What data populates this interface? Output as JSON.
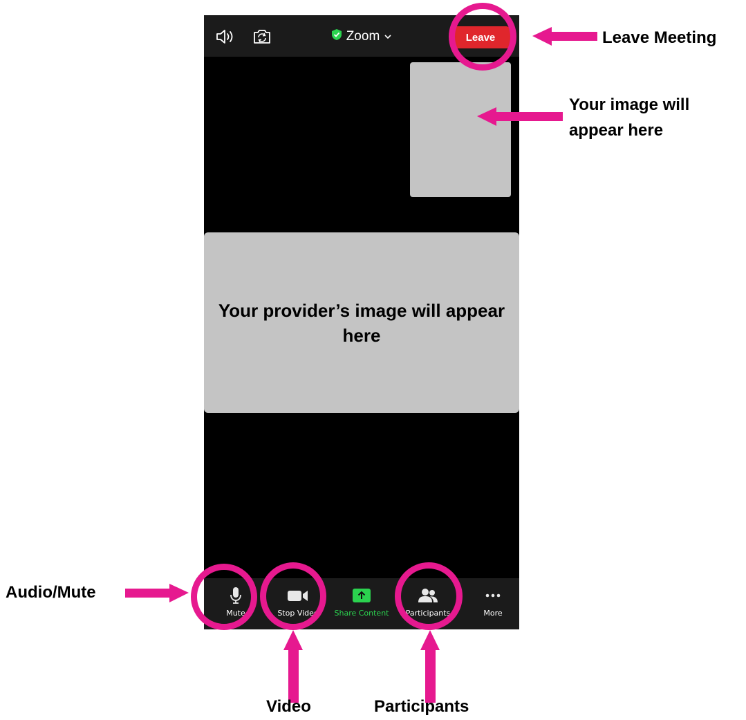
{
  "topbar": {
    "speaker_icon": "speaker-icon",
    "camera_switch_icon": "camera-switch-icon",
    "shield_icon": "shield-check-icon",
    "title": "Zoom",
    "leave_label": "Leave"
  },
  "self_view": {
    "text": ""
  },
  "provider_view": {
    "text": "Your provider’s image will appear here"
  },
  "toolbar": {
    "items": [
      {
        "label": "Mute",
        "icon": "microphone-icon"
      },
      {
        "label": "Stop Video",
        "icon": "video-camera-icon"
      },
      {
        "label": "Share Content",
        "icon": "share-arrow-icon"
      },
      {
        "label": "Participants",
        "icon": "participants-icon"
      },
      {
        "label": "More",
        "icon": "more-dots-icon"
      }
    ]
  },
  "annotations": {
    "leave": "Leave Meeting",
    "self_image_line1": "Your image will",
    "self_image_line2": "appear here",
    "audio": "Audio/Mute",
    "video": "Video",
    "participants": "Participants"
  },
  "colors": {
    "accent_pink": "#e6198f",
    "leave_red": "#e0262c",
    "share_green": "#2bd24f",
    "bar_dark": "#1b1b1b",
    "placeholder_gray": "#c4c4c4"
  }
}
